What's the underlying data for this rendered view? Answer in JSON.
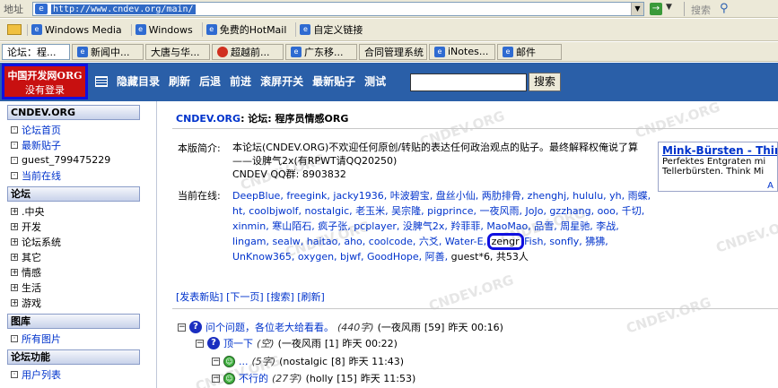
{
  "addressbar": {
    "label": "地址",
    "url": "http://www.cndev.org/main/",
    "search_label": "搜索"
  },
  "links": [
    "Windows Media",
    "Windows",
    "免费的HotMail",
    "自定义链接"
  ],
  "tabs": [
    "论坛：程...",
    "新闻中...",
    "大唐与华...",
    "超越前...",
    "广东移...",
    "合同管理系统",
    "iNotes...",
    "邮件"
  ],
  "logo": {
    "line1": "中国开发网ORG",
    "line2": "没有登录"
  },
  "nav": [
    "隐藏目录",
    "刷新",
    "后退",
    "前进",
    "滚屏开关",
    "最新贴子",
    "测试"
  ],
  "nav_search_button": "搜索",
  "sidebar": {
    "sec1": "CNDEV.ORG",
    "sec1_items": [
      "论坛首页",
      "最新贴子",
      "guest_799475229",
      "当前在线"
    ],
    "sec2": "论坛",
    "sec2_items": [
      ".中央",
      "开发",
      "论坛系统",
      "其它",
      "情感",
      "生活",
      "游戏"
    ],
    "sec3": "图库",
    "sec3_items": [
      "所有图片"
    ],
    "sec4": "论坛功能",
    "sec4_items": [
      "用户列表"
    ]
  },
  "main": {
    "crumb_brand": "CNDEV.ORG",
    "crumb_rest": ": 论坛: 程序员情感ORG",
    "intro_label": "本版简介:",
    "intro_text": "本论坛(CNDEV.ORG)不欢迎任何原创/转贴的表达任何政治观点的贴子。最终解释权俺说了算——设脾气2x(有RPWT请QQ20250)",
    "intro_qq": "CNDEV QQ群: 8903832",
    "online_label": "当前在线:",
    "online_users": "DeepBlue, freegink, jacky1936, 咔波碧宝, 盘丝小仙, 两肋排骨, zhenghj, hululu, yh, 雨蝶, ht, coolbjwolf, nostalgic, 老玉米, 吴宗隆, pigprince, 一夜风雨, JoJo, gzzhang, ooo, 千切, xinmin, 寒山陌石, 疯子张, pcplayer, 没脾气2x, 羚菲菲, MaoMao, 品雪, 周星驰, 李战, lingam, sealw, haitao, aho, coolcode, 六爻, Water-E,",
    "online_highlight": "zengr",
    "online_users2": "Fish, sonfly, 狒狒, UnKnow365, oxygen, bjwf, GoodHope, 阿善,",
    "online_tail": "guest*6, 共53人",
    "actions": "[发表新贴] [下一页] [搜索] [刷新]"
  },
  "ad": {
    "title": "Mink-Bürsten - Thin",
    "line1": "Perfektes Entgraten mi",
    "line2": "Tellerbürsten. Think Mi",
    "foot": "A"
  },
  "threads": [
    {
      "title": "问个问题，各位老大给看看。",
      "count": "(440字)",
      "author": "(一夜风雨",
      "replies": "[59]",
      "time": "昨天 00:16)"
    },
    {
      "title": "顶一下",
      "count": "(空)",
      "author": "(一夜风雨",
      "replies": "[1]",
      "time": "昨天 00:22)"
    },
    {
      "title": "...",
      "count": "(5字)",
      "author": "(nostalgic",
      "replies": "[8]",
      "time": "昨天 11:43)"
    },
    {
      "title": "不行的",
      "count": "(27字)",
      "author": "(holly",
      "replies": "[15]",
      "time": "昨天 11:53)"
    }
  ],
  "watermark": "CNDEV.ORG"
}
